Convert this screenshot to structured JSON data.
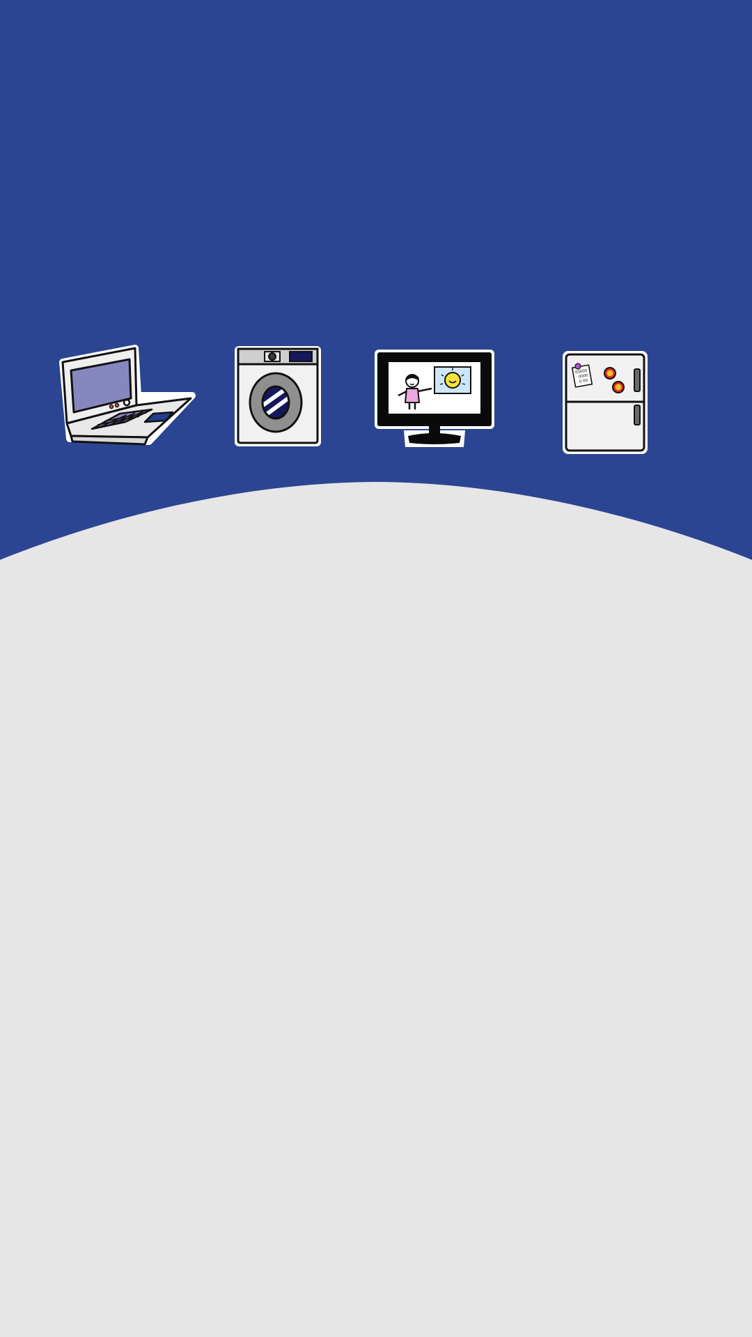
{
  "colors": {
    "header_blue": "#2c4592",
    "body_gray": "#e6e6e7",
    "appliance_white": "#f1f1f1",
    "laptop_screen": "#8787c0",
    "washer_gray": "#8f8f8f",
    "washer_navy": "#15185a",
    "tv_frame": "#0a0a0a",
    "tv_weather_panel": "#cde5f7",
    "sun_yellow": "#f7e23d",
    "person_pink": "#eaa8df",
    "magnet_red": "#e2262b",
    "magnet_yellow": "#f2c21d"
  },
  "illustrations": [
    {
      "name": "laptop-icon"
    },
    {
      "name": "washing-machine-icon"
    },
    {
      "name": "television-icon"
    },
    {
      "name": "refrigerator-icon"
    }
  ],
  "fridge_note": {
    "line1": "00000",
    "line2": "- 0000",
    "line3": "- 0 00"
  }
}
